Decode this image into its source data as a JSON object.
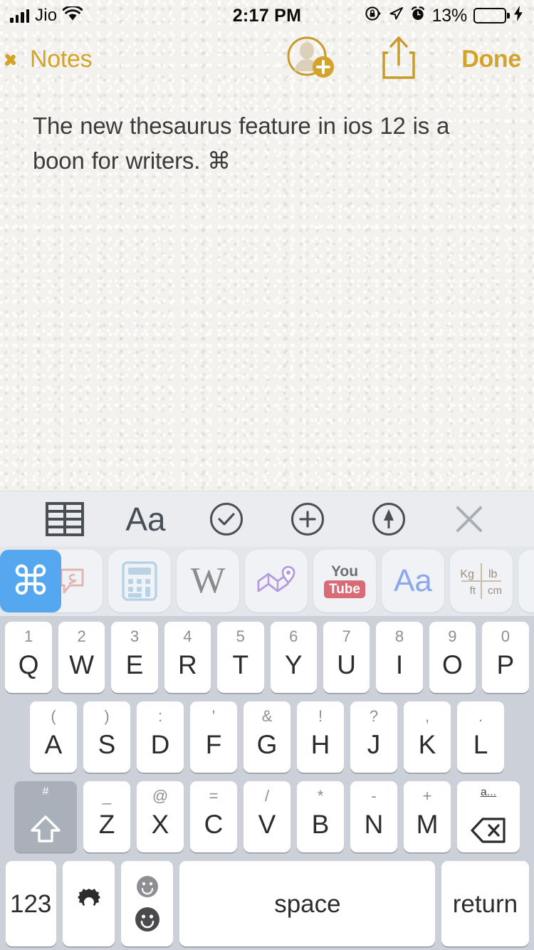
{
  "status_bar": {
    "carrier": "Jio",
    "signal_icon": "cellular-bars-icon",
    "wifi_icon": "wifi-icon",
    "time": "2:17 PM",
    "rotation_lock_icon": "rotation-lock-icon",
    "location_icon": "location-arrow-icon",
    "alarm_icon": "alarm-clock-icon",
    "battery_percent": "13%",
    "battery_level": 13,
    "battery_color": "#f1342a",
    "charging_icon": "lightning-bolt-icon"
  },
  "nav_bar": {
    "back_label": "Notes",
    "back_icon": "chevron-left-icon",
    "add_person_icon": "add-person-icon",
    "share_icon": "share-upload-icon",
    "done_label": "Done",
    "tint_color": "#d3a32a"
  },
  "note": {
    "text": "The new thesaurus feature in ios 12 is a boon for writers. ⌘"
  },
  "format_toolbar": {
    "items": [
      {
        "name": "table-icon",
        "label": ""
      },
      {
        "name": "text-format-icon",
        "label": "Aa"
      },
      {
        "name": "checklist-icon",
        "label": ""
      },
      {
        "name": "add-attachment-icon",
        "label": ""
      },
      {
        "name": "markup-pen-icon",
        "label": ""
      },
      {
        "name": "close-icon",
        "label": ""
      }
    ]
  },
  "app_shortcuts": {
    "items": [
      {
        "name": "command-shortcut-app",
        "label": "⌘",
        "selected": true
      },
      {
        "name": "speech-bubble-app",
        "label": "",
        "selected": false
      },
      {
        "name": "calculator-app",
        "label": "",
        "selected": false
      },
      {
        "name": "wikipedia-app",
        "label": "W",
        "selected": false
      },
      {
        "name": "maps-app",
        "label": "",
        "selected": false
      },
      {
        "name": "youtube-app",
        "label": "You Tube",
        "selected": false
      },
      {
        "name": "dictionary-app",
        "label": "Aa",
        "selected": false
      },
      {
        "name": "unit-converter-app",
        "label": "Kg lb ft cm",
        "selected": false
      },
      {
        "name": "contacts-app",
        "label": "",
        "selected": false
      }
    ],
    "selected_color": "#55a7ef"
  },
  "keyboard": {
    "row1": [
      {
        "sub": "1",
        "main": "Q"
      },
      {
        "sub": "2",
        "main": "W"
      },
      {
        "sub": "3",
        "main": "E"
      },
      {
        "sub": "4",
        "main": "R"
      },
      {
        "sub": "5",
        "main": "T"
      },
      {
        "sub": "6",
        "main": "Y"
      },
      {
        "sub": "7",
        "main": "U"
      },
      {
        "sub": "8",
        "main": "I"
      },
      {
        "sub": "9",
        "main": "O"
      },
      {
        "sub": "0",
        "main": "P"
      }
    ],
    "row2": [
      {
        "sub": "(",
        "main": "A"
      },
      {
        "sub": ")",
        "main": "S"
      },
      {
        "sub": ":",
        "main": "D"
      },
      {
        "sub": "'",
        "main": "F"
      },
      {
        "sub": "&",
        "main": "G"
      },
      {
        "sub": "!",
        "main": "H"
      },
      {
        "sub": "?",
        "main": "J"
      },
      {
        "sub": ",",
        "main": "K"
      },
      {
        "sub": ".",
        "main": "L"
      }
    ],
    "shift": {
      "sub": "#",
      "icon": "shift-arrow-icon"
    },
    "row3": [
      {
        "sub": "_",
        "main": "Z"
      },
      {
        "sub": "@",
        "main": "X"
      },
      {
        "sub": "=",
        "main": "C"
      },
      {
        "sub": "/",
        "main": "V"
      },
      {
        "sub": "*",
        "main": "B"
      },
      {
        "sub": "-",
        "main": "N"
      },
      {
        "sub": "+",
        "main": "M"
      }
    ],
    "delete": {
      "sub": "a...",
      "icon": "backspace-icon"
    },
    "row4": {
      "numbers_label": "123",
      "settings_icon": "gear-icon",
      "emoji_icon": "emoji-smiley-icon",
      "space_label": "space",
      "return_label": "return"
    }
  }
}
